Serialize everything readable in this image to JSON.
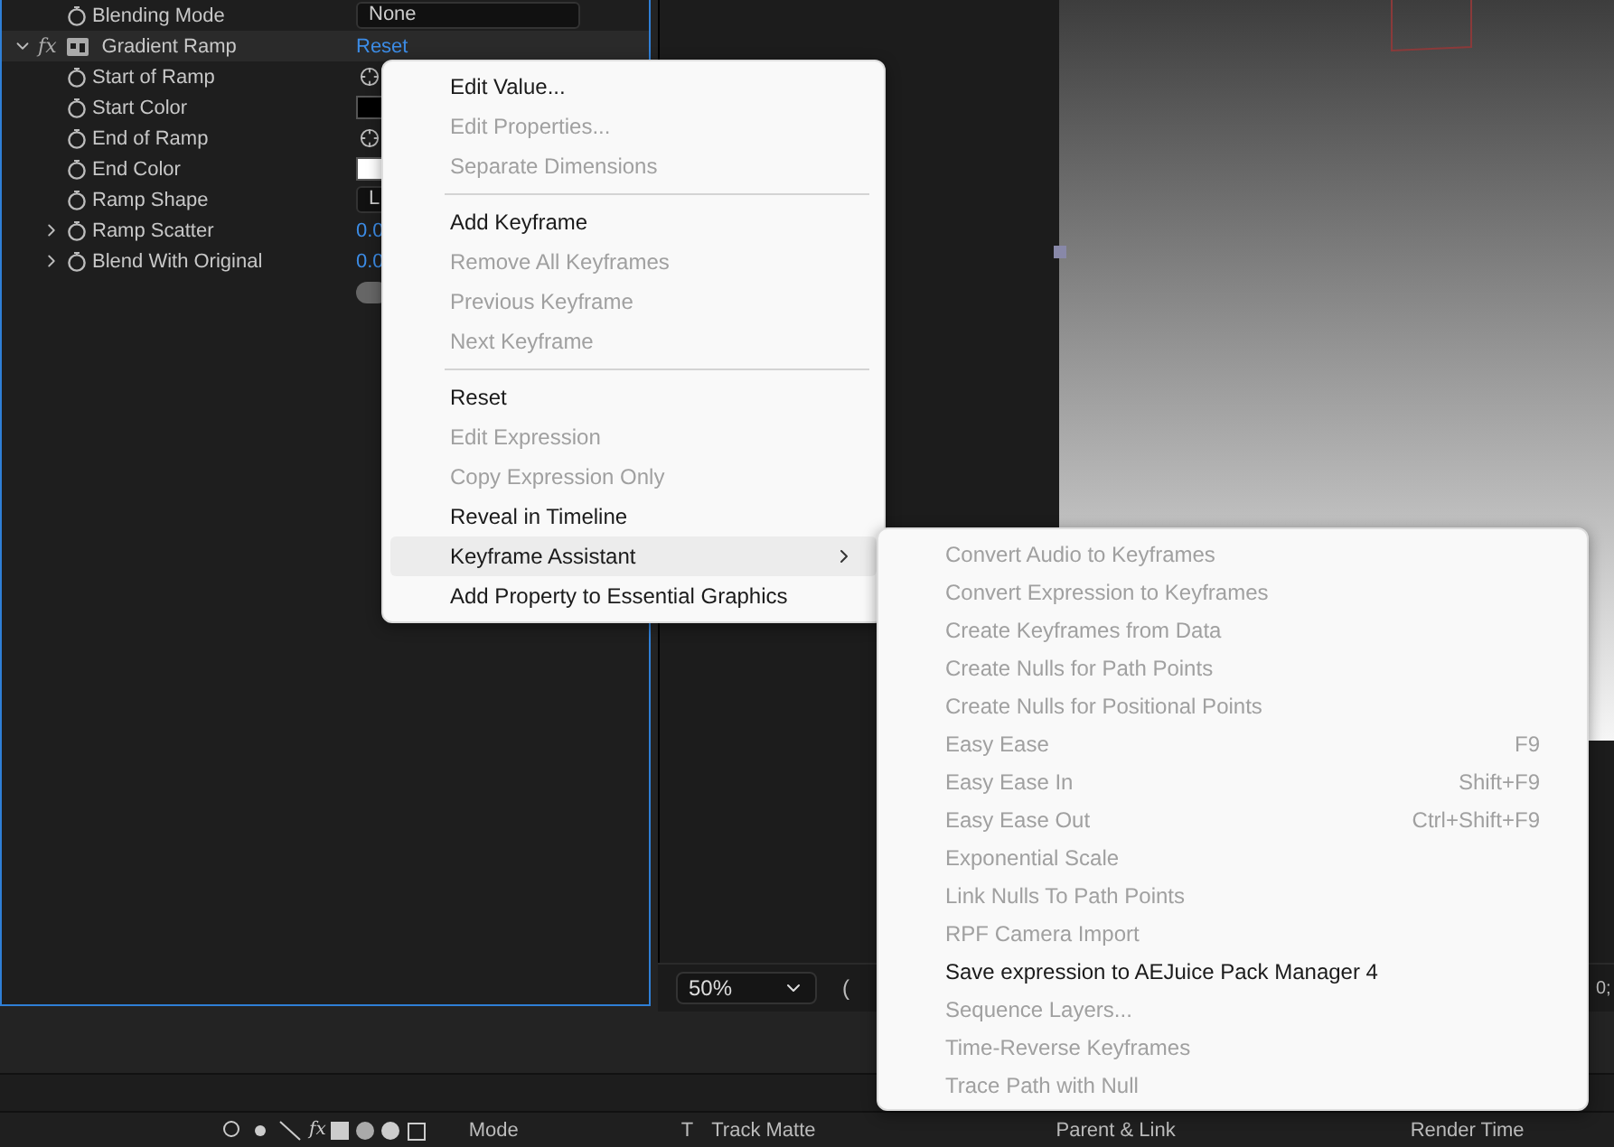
{
  "effect_controls": {
    "blending_row": {
      "label": "Blending Mode",
      "value": "None"
    },
    "effect": {
      "fx": "fx",
      "name": "Gradient Ramp",
      "reset": "Reset",
      "expanded": true
    },
    "properties": [
      {
        "name": "Start of Ramp",
        "kind": "point"
      },
      {
        "name": "Start Color",
        "kind": "color",
        "color": "#000000"
      },
      {
        "name": "End of Ramp",
        "kind": "point"
      },
      {
        "name": "End Color",
        "kind": "color",
        "color": "#ffffff"
      },
      {
        "name": "Ramp Shape",
        "kind": "dropdown",
        "value": "L"
      },
      {
        "name": "Ramp Scatter",
        "kind": "number",
        "value": "0.0"
      },
      {
        "name": "Blend With Original",
        "kind": "number",
        "value": "0.0"
      },
      {
        "kind": "toggle",
        "on": false
      }
    ]
  },
  "viewer": {
    "zoom": "50%",
    "field_2": "(",
    "field_3": "0;"
  },
  "timeline": {
    "fx": "fx",
    "columns": [
      "Mode",
      "T",
      "Track Matte",
      "Parent & Link",
      "Render Time"
    ]
  },
  "context_menu": {
    "items": [
      {
        "kind": "item",
        "label": "Edit Value...",
        "disabled": false,
        "highlighted": false
      },
      {
        "kind": "item",
        "label": "Edit Properties...",
        "disabled": true,
        "highlighted": false
      },
      {
        "kind": "item",
        "label": "Separate Dimensions",
        "disabled": true,
        "highlighted": false
      },
      {
        "kind": "separator"
      },
      {
        "kind": "item",
        "label": "Add Keyframe",
        "disabled": false,
        "highlighted": false
      },
      {
        "kind": "item",
        "label": "Remove All Keyframes",
        "disabled": true,
        "highlighted": false
      },
      {
        "kind": "item",
        "label": "Previous Keyframe",
        "disabled": true,
        "highlighted": false
      },
      {
        "kind": "item",
        "label": "Next Keyframe",
        "disabled": true,
        "highlighted": false
      },
      {
        "kind": "separator"
      },
      {
        "kind": "item",
        "label": "Reset",
        "disabled": false,
        "highlighted": false
      },
      {
        "kind": "item",
        "label": "Edit Expression",
        "disabled": true,
        "highlighted": false
      },
      {
        "kind": "item",
        "label": "Copy Expression Only",
        "disabled": true,
        "highlighted": false
      },
      {
        "kind": "item",
        "label": "Reveal in Timeline",
        "disabled": false,
        "highlighted": false
      },
      {
        "kind": "submenu",
        "label": "Keyframe Assistant",
        "disabled": false,
        "highlighted": true
      },
      {
        "kind": "item",
        "label": "Add Property to Essential Graphics",
        "disabled": false,
        "highlighted": false
      }
    ]
  },
  "submenu": {
    "items": [
      {
        "label": "Convert Audio to Keyframes",
        "disabled": true
      },
      {
        "label": "Convert Expression to Keyframes",
        "disabled": true
      },
      {
        "label": "Create Keyframes from Data",
        "disabled": true
      },
      {
        "label": "Create Nulls for Path Points",
        "disabled": true
      },
      {
        "label": "Create Nulls for Positional Points",
        "disabled": true
      },
      {
        "label": "Easy Ease",
        "disabled": true,
        "shortcut": "F9"
      },
      {
        "label": "Easy Ease In",
        "disabled": true,
        "shortcut": "Shift+F9"
      },
      {
        "label": "Easy Ease Out",
        "disabled": true,
        "shortcut": "Ctrl+Shift+F9"
      },
      {
        "label": "Exponential Scale",
        "disabled": true
      },
      {
        "label": "Link Nulls To Path Points",
        "disabled": true
      },
      {
        "label": "RPF Camera Import",
        "disabled": true
      },
      {
        "label": "Save expression to AEJuice Pack Manager 4",
        "disabled": false
      },
      {
        "label": "Sequence Layers...",
        "disabled": true
      },
      {
        "label": "Time-Reverse Keyframes",
        "disabled": true
      },
      {
        "label": "Trace Path with Null",
        "disabled": true
      }
    ]
  }
}
